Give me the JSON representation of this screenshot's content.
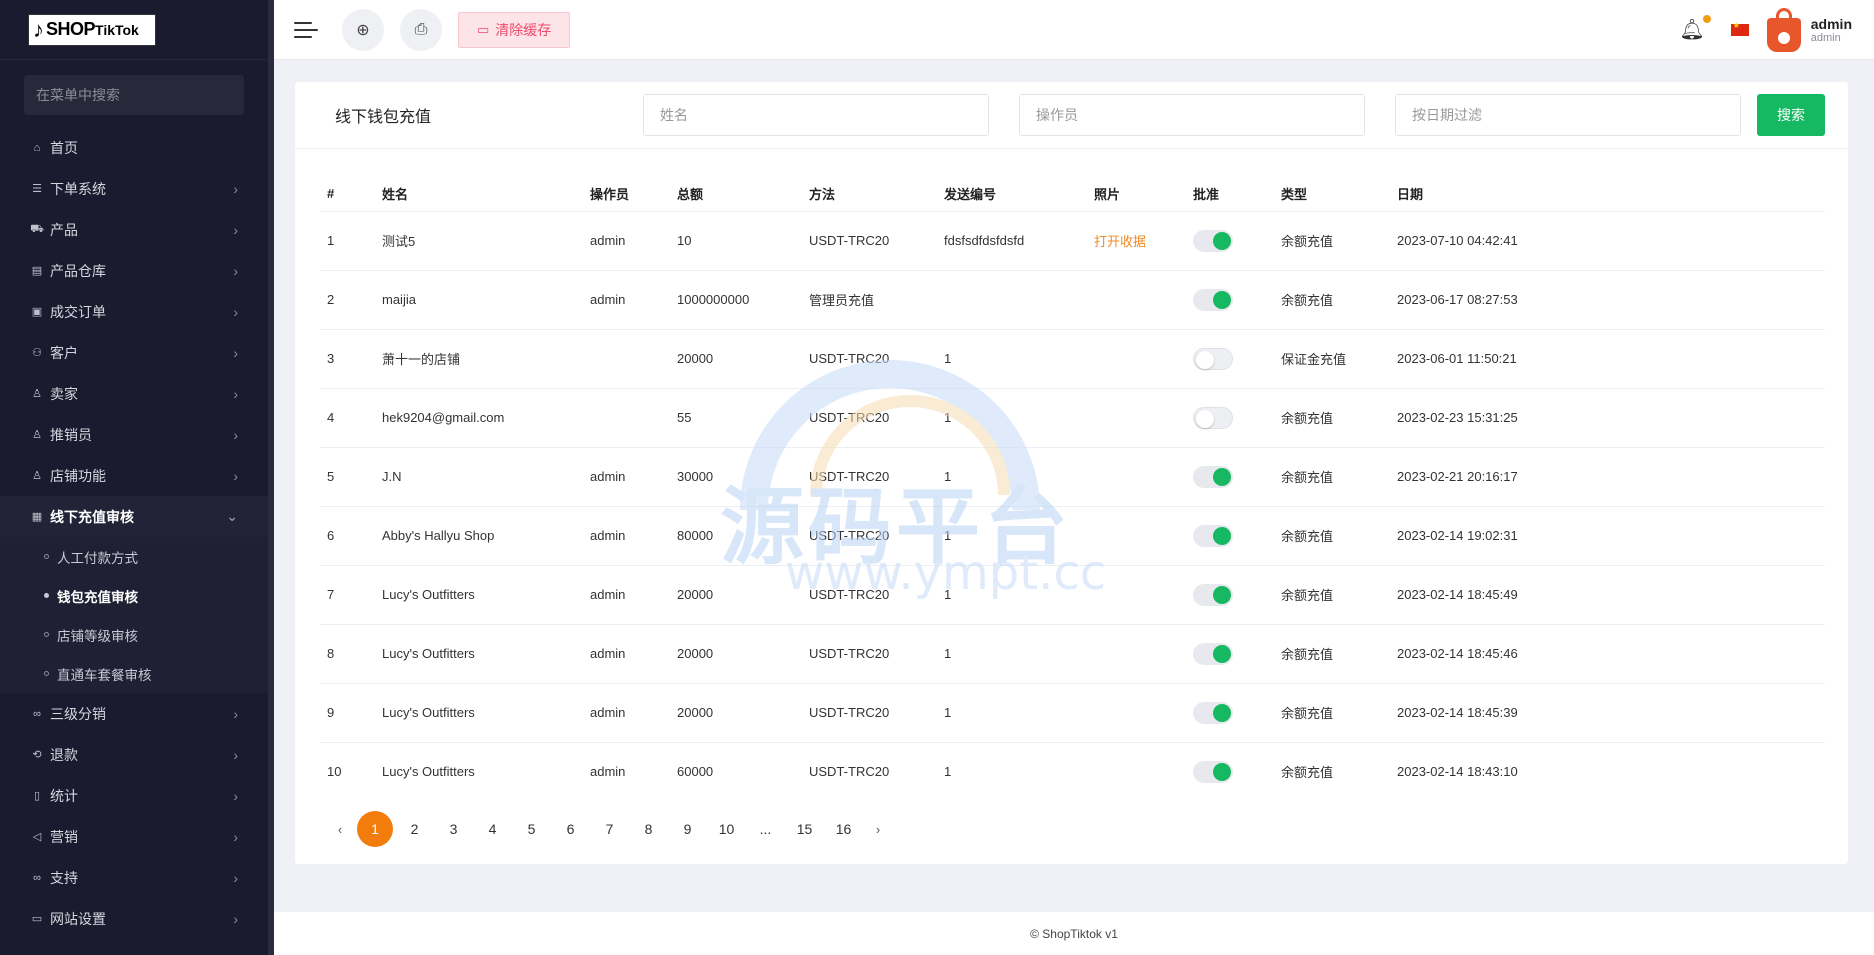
{
  "app": {
    "logo_text": "SHOPTikTok",
    "footer": "© ShopTiktok v1"
  },
  "sidebar": {
    "search_placeholder": "在菜单中搜索",
    "items": [
      {
        "label": "首页",
        "icon": "home-icon",
        "has_children": false
      },
      {
        "label": "下单系统",
        "icon": "list-icon",
        "has_children": true
      },
      {
        "label": "产品",
        "icon": "cart-icon",
        "has_children": true
      },
      {
        "label": "产品仓库",
        "icon": "warehouse-icon",
        "has_children": true
      },
      {
        "label": "成交订单",
        "icon": "order-icon",
        "has_children": true
      },
      {
        "label": "客户",
        "icon": "users-icon",
        "has_children": true
      },
      {
        "label": "卖家",
        "icon": "user-icon",
        "has_children": true
      },
      {
        "label": "推销员",
        "icon": "user-icon",
        "has_children": true
      },
      {
        "label": "店铺功能",
        "icon": "user-icon",
        "has_children": true
      },
      {
        "label": "线下充值审核",
        "icon": "money-icon",
        "has_children": true,
        "expanded": true
      },
      {
        "label": "三级分销",
        "icon": "link-icon",
        "has_children": true
      },
      {
        "label": "退款",
        "icon": "refund-icon",
        "has_children": true
      },
      {
        "label": "统计",
        "icon": "document-icon",
        "has_children": true
      },
      {
        "label": "营销",
        "icon": "megaphone-icon",
        "has_children": true
      },
      {
        "label": "支持",
        "icon": "link-icon",
        "has_children": true
      },
      {
        "label": "网站设置",
        "icon": "monitor-icon",
        "has_children": true
      }
    ],
    "submenu": [
      {
        "label": "人工付款方式",
        "active": false
      },
      {
        "label": "钱包充值审核",
        "active": true
      },
      {
        "label": "店铺等级审核",
        "active": false
      },
      {
        "label": "直通车套餐审核",
        "active": false
      }
    ]
  },
  "header": {
    "clear_cache_label": "清除缓存",
    "user_name": "admin",
    "user_role": "admin"
  },
  "card": {
    "title": "线下钱包充值",
    "filters": {
      "name_placeholder": "姓名",
      "operator_placeholder": "操作员",
      "date_placeholder": "按日期过滤"
    },
    "search_label": "搜索"
  },
  "table": {
    "columns": [
      "#",
      "姓名",
      "操作员",
      "总额",
      "方法",
      "发送编号",
      "照片",
      "批准",
      "类型",
      "日期"
    ],
    "rows": [
      {
        "num": "1",
        "name": "测试5",
        "operator": "admin",
        "amount": "10",
        "method": "USDT-TRC20",
        "send_no": "fdsfsdfdsfdsfd",
        "photo": "打开收据",
        "approved": true,
        "type": "余额充值",
        "date": "2023-07-10 04:42:41"
      },
      {
        "num": "2",
        "name": "maijia",
        "operator": "admin",
        "amount": "1000000000",
        "method": "管理员充值",
        "send_no": "",
        "photo": "",
        "approved": true,
        "type": "余额充值",
        "date": "2023-06-17 08:27:53"
      },
      {
        "num": "3",
        "name": "萧十一的店铺",
        "operator": "",
        "amount": "20000",
        "method": "USDT-TRC20",
        "send_no": "1",
        "photo": "",
        "approved": false,
        "type": "保证金充值",
        "date": "2023-06-01 11:50:21"
      },
      {
        "num": "4",
        "name": "hek9204@gmail.com",
        "operator": "",
        "amount": "55",
        "method": "USDT-TRC20",
        "send_no": "1",
        "photo": "",
        "approved": false,
        "type": "余额充值",
        "date": "2023-02-23 15:31:25"
      },
      {
        "num": "5",
        "name": "J.N",
        "operator": "admin",
        "amount": "30000",
        "method": "USDT-TRC20",
        "send_no": "1",
        "photo": "",
        "approved": true,
        "type": "余额充值",
        "date": "2023-02-21 20:16:17"
      },
      {
        "num": "6",
        "name": "Abby's Hallyu Shop",
        "operator": "admin",
        "amount": "80000",
        "method": "USDT-TRC20",
        "send_no": "1",
        "photo": "",
        "approved": true,
        "type": "余额充值",
        "date": "2023-02-14 19:02:31"
      },
      {
        "num": "7",
        "name": "Lucy's Outfitters",
        "operator": "admin",
        "amount": "20000",
        "method": "USDT-TRC20",
        "send_no": "1",
        "photo": "",
        "approved": true,
        "type": "余额充值",
        "date": "2023-02-14 18:45:49"
      },
      {
        "num": "8",
        "name": "Lucy's Outfitters",
        "operator": "admin",
        "amount": "20000",
        "method": "USDT-TRC20",
        "send_no": "1",
        "photo": "",
        "approved": true,
        "type": "余额充值",
        "date": "2023-02-14 18:45:46"
      },
      {
        "num": "9",
        "name": "Lucy's Outfitters",
        "operator": "admin",
        "amount": "20000",
        "method": "USDT-TRC20",
        "send_no": "1",
        "photo": "",
        "approved": true,
        "type": "余额充值",
        "date": "2023-02-14 18:45:39"
      },
      {
        "num": "10",
        "name": "Lucy's Outfitters",
        "operator": "admin",
        "amount": "60000",
        "method": "USDT-TRC20",
        "send_no": "1",
        "photo": "",
        "approved": true,
        "type": "余额充值",
        "date": "2023-02-14 18:43:10"
      }
    ]
  },
  "pagination": {
    "prev": "‹",
    "next": "›",
    "pages": [
      "1",
      "2",
      "3",
      "4",
      "5",
      "6",
      "7",
      "8",
      "9",
      "10",
      "...",
      "15",
      "16"
    ],
    "current": "1"
  },
  "watermark": {
    "text": "源码平台",
    "url": "www.ympt.cc"
  },
  "colors": {
    "sidebar_bg": "#1a1b2e",
    "accent_green": "#16b861",
    "accent_orange": "#f27d0c",
    "cache_btn_text": "#ee4d6b"
  }
}
